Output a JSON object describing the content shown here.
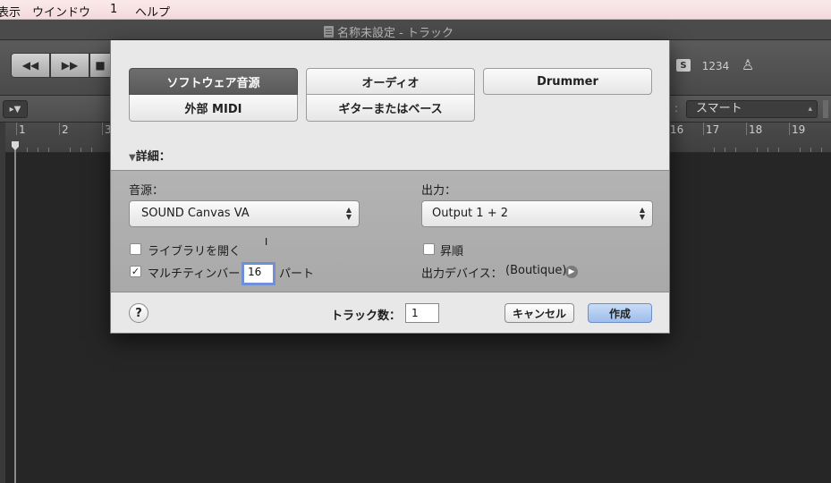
{
  "menubar": {
    "items": [
      "表示",
      "ウインドウ",
      "1",
      "ヘルプ"
    ]
  },
  "window": {
    "title": "名称未設定 - トラック"
  },
  "toolbar": {
    "solo_label": "S",
    "count_label": "1234"
  },
  "trackbar": {
    "mode_select": "スマート"
  },
  "ruler": {
    "left_bars": [
      "1",
      "2",
      "3"
    ],
    "right_bars": [
      "16",
      "17",
      "18",
      "19"
    ]
  },
  "dialog": {
    "track_types": {
      "software_instrument": "ソフトウェア音源",
      "audio": "オーディオ",
      "drummer": "Drummer",
      "external_midi": "外部 MIDI",
      "guitar_bass": "ギターまたはベース"
    },
    "details": {
      "toggle_label": "詳細：",
      "instrument_label": "音源：",
      "instrument_value": "SOUND Canvas VA",
      "output_label": "出力：",
      "output_value": "Output 1 + 2",
      "open_library_label": "ライブラリを開く",
      "open_library_checked": false,
      "ascending_label": "昇順",
      "ascending_checked": false,
      "multitimbral_label": "マルチティンバー",
      "multitimbral_checked": true,
      "multitimbral_parts": "16",
      "parts_label": "パート",
      "output_device_label": "出力デバイス：",
      "output_device_value": "(Boutique)"
    },
    "footer": {
      "help_label": "?",
      "track_count_label": "トラック数：",
      "track_count_value": "1",
      "cancel_label": "キャンセル",
      "create_label": "作成"
    }
  }
}
